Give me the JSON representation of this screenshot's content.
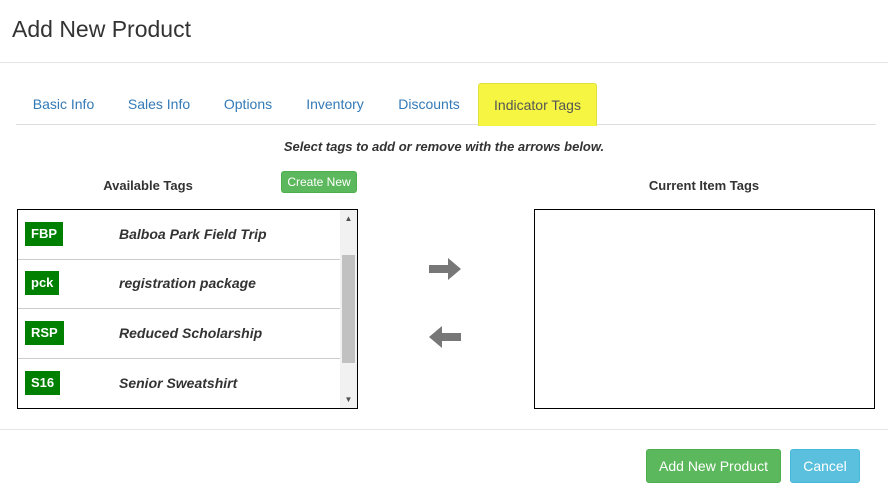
{
  "modal": {
    "title": "Add New Product"
  },
  "tabs": [
    {
      "label": "Basic Info"
    },
    {
      "label": "Sales Info"
    },
    {
      "label": "Options"
    },
    {
      "label": "Inventory"
    },
    {
      "label": "Discounts"
    },
    {
      "label": "Indicator Tags",
      "active": true
    }
  ],
  "instruction": "Select tags to add or remove with the arrows below.",
  "available": {
    "label": "Available Tags",
    "create_label": "Create New",
    "tags": [
      {
        "code": "FBP",
        "name": "Balboa Park Field Trip"
      },
      {
        "code": "pck",
        "name": "registration package"
      },
      {
        "code": "RSP",
        "name": "Reduced Scholarship"
      },
      {
        "code": "S16",
        "name": "Senior Sweatshirt"
      }
    ]
  },
  "current": {
    "label": "Current Item Tags",
    "tags": []
  },
  "arrows": {
    "add_icon": "arrow-right-icon",
    "remove_icon": "arrow-left-icon"
  },
  "footer": {
    "add_label": "Add New Product",
    "cancel_label": "Cancel"
  },
  "colors": {
    "active_tab": "#f5f542",
    "tag_badge": "#008000",
    "success": "#5cb85c",
    "info": "#5bc0de",
    "link": "#337ab7"
  }
}
